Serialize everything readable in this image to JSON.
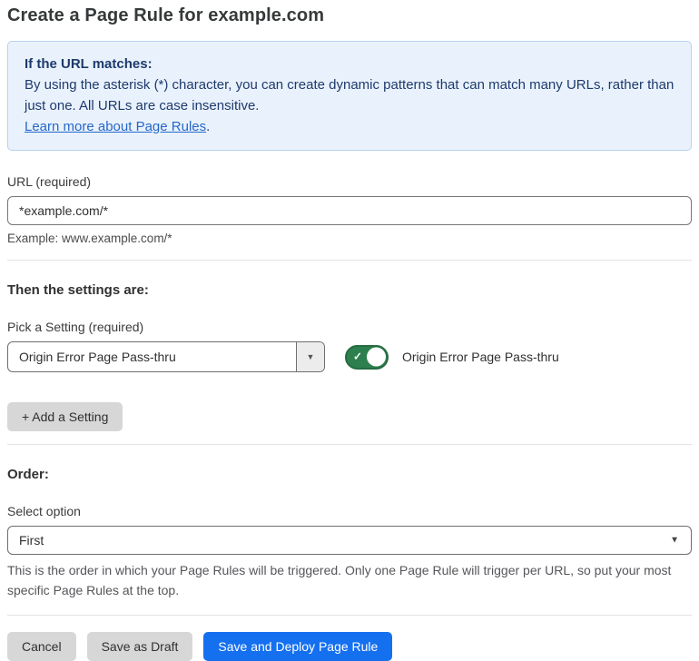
{
  "page": {
    "title": "Create a Page Rule for example.com"
  },
  "info_box": {
    "heading": "If the URL matches:",
    "body": "By using the asterisk (*) character, you can create dynamic patterns that can match many URLs, rather than just one. All URLs are case insensitive.",
    "link": "Learn more about Page Rules",
    "link_suffix": "."
  },
  "url_field": {
    "label": "URL (required)",
    "value": "*example.com/*",
    "helper": "Example: www.example.com/*"
  },
  "settings_section": {
    "heading": "Then the settings are:",
    "picker_label": "Pick a Setting (required)",
    "picker_value": "Origin Error Page Pass-thru",
    "toggle_state": "on",
    "toggle_label": "Origin Error Page Pass-thru",
    "add_button_label": "+ Add a Setting"
  },
  "order_section": {
    "heading": "Order:",
    "select_label": "Select option",
    "select_value": "First",
    "helper": "This is the order in which your Page Rules will be triggered. Only one Page Rule will trigger per URL, so put your most specific Page Rules at the top."
  },
  "footer": {
    "cancel_label": "Cancel",
    "save_draft_label": "Save as Draft",
    "save_deploy_label": "Save and Deploy Page Rule"
  },
  "icons": {
    "dropdown_arrow": "▼",
    "select_arrow": "▼",
    "toggle_check": "✓"
  },
  "colors": {
    "accent_blue": "#1570ef",
    "info_bg": "#e9f2fc",
    "info_border": "#b7d3ef",
    "info_text": "#1e3a6d",
    "link_blue": "#2667c9",
    "toggle_green": "#2e7f4e",
    "toggle_border_green": "#266c42",
    "button_gray": "#d7d7d7"
  }
}
